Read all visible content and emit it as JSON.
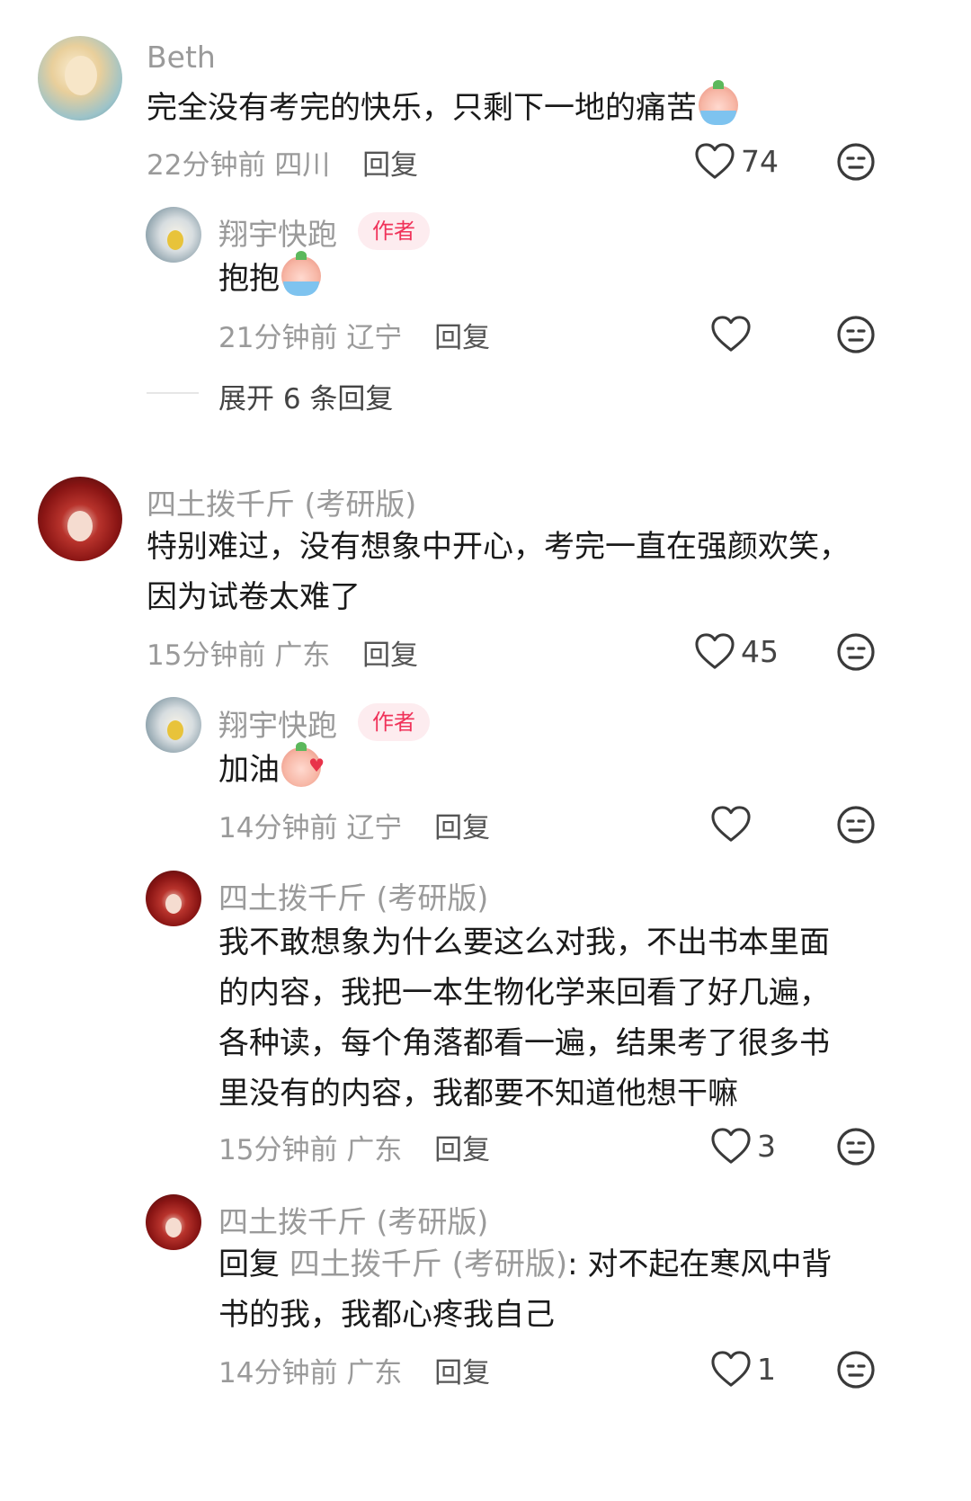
{
  "comments": [
    {
      "name": "Beth",
      "text": "完全没有考完的快乐，只剩下一地的痛苦",
      "time": "22分钟前",
      "location": "四川",
      "reply_label": "回复",
      "likes": "74",
      "replies": [
        {
          "name": "翔宇快跑",
          "badge": "作者",
          "text": "抱抱",
          "time": "21分钟前",
          "location": "辽宁",
          "reply_label": "回复"
        }
      ],
      "expand_label": "展开 6 条回复"
    },
    {
      "name": "四土拨千斤 (考研版)",
      "text_line1": "特别难过，没有想象中开心，考完一直在强颜欢笑，",
      "text_line2": "因为试卷太难了",
      "time": "15分钟前",
      "location": "广东",
      "reply_label": "回复",
      "likes": "45",
      "replies": [
        {
          "name": "翔宇快跑",
          "badge": "作者",
          "text": "加油",
          "time": "14分钟前",
          "location": "辽宁",
          "reply_label": "回复"
        },
        {
          "name": "四土拨千斤 (考研版)",
          "lines": [
            "我不敢想象为什么要这么对我，不出书本里面",
            "的内容，我把一本生物化学来回看了好几遍，",
            "各种读，每个角落都看一遍，结果考了很多书",
            "里没有的内容，我都要不知道他想干嘛"
          ],
          "time": "15分钟前",
          "location": "广东",
          "reply_label": "回复",
          "likes": "3"
        },
        {
          "name": "四土拨千斤 (考研版)",
          "reply_prefix": "回复 ",
          "quoted_name": "四土拨千斤 (考研版)",
          "text_after": ": 对不起在寒风中背",
          "line2": "书的我，我都心疼我自己",
          "time": "14分钟前",
          "location": "广东",
          "reply_label": "回复",
          "likes": "1"
        }
      ]
    }
  ],
  "icons": {
    "like": "heart-outline-icon",
    "dislike": "meh-face-icon",
    "emoji_cry": "crying-peach-emoji",
    "emoji_kiss": "kissing-peach-emoji"
  },
  "colors": {
    "badge_text": "#f0335a",
    "badge_bg": "#fdecef",
    "meta_text": "#9a9a9a"
  }
}
